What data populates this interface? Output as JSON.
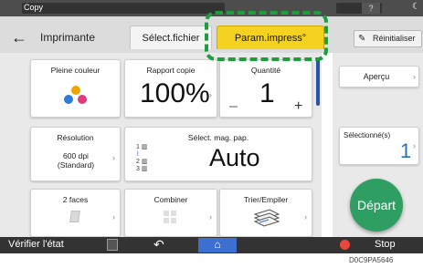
{
  "status_bar": {
    "title": "Copy"
  },
  "tabs": {
    "back": "←",
    "printer": "Imprimante",
    "file_select": "Sélect.fichier",
    "print_settings": "Param.impress°",
    "reset": "Réinitialiser"
  },
  "cards": {
    "color": {
      "title": "Pleine couleur"
    },
    "ratio": {
      "title": "Rapport copie",
      "value": "100%"
    },
    "quantity": {
      "title": "Quantité",
      "value": "1",
      "minus": "–",
      "plus": "+"
    },
    "resolution": {
      "title": "Résolution",
      "value_line1": "600 dpi",
      "value_line2": "(Standard)"
    },
    "paper": {
      "title": "Sélect. mag. pap.",
      "value": "Auto",
      "trays": [
        "1",
        "2",
        "3"
      ]
    },
    "duplex": {
      "title": "2 faces"
    },
    "combine": {
      "title": "Combiner"
    },
    "sort": {
      "title": "Trier/Empiler"
    }
  },
  "right": {
    "preview": "Aperçu",
    "selected_label": "Sélectionné(s)",
    "selected_value": "1",
    "start": "Départ"
  },
  "bottom": {
    "check_status": "Vérifier l'état",
    "stop": "Stop"
  },
  "caption": "D0C9PA5646",
  "colors": {
    "accent_tab": "#f5d21f",
    "highlight": "#1c9e3d",
    "start_button": "#2e9e63",
    "home": "#3d6fd0"
  }
}
